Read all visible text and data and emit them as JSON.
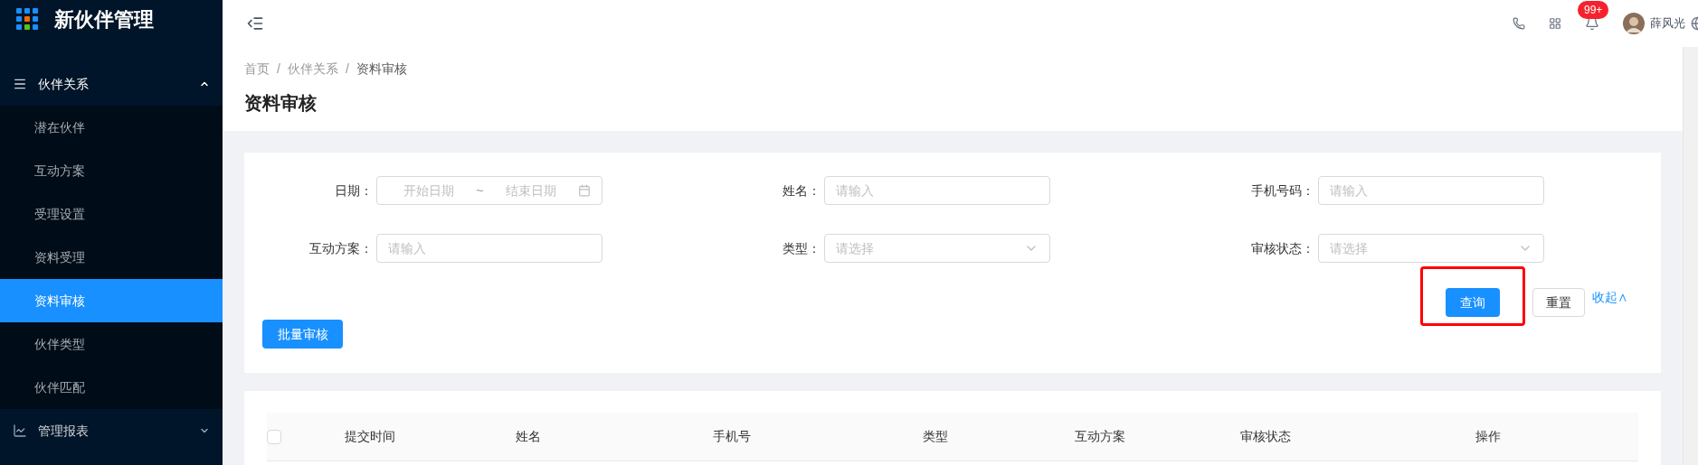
{
  "app": {
    "title": "新伙伴管理"
  },
  "sidebar": {
    "groups": [
      {
        "label": "伙伴关系",
        "kind": "list",
        "expanded": true,
        "children": [
          {
            "label": "潜在伙伴",
            "selected": false
          },
          {
            "label": "互动方案",
            "selected": false
          },
          {
            "label": "受理设置",
            "selected": false
          },
          {
            "label": "资料受理",
            "selected": false
          },
          {
            "label": "资料审核",
            "selected": true
          },
          {
            "label": "伙伴类型",
            "selected": false
          },
          {
            "label": "伙伴匹配",
            "selected": false
          }
        ]
      },
      {
        "label": "管理报表",
        "kind": "chart",
        "expanded": false
      }
    ]
  },
  "header": {
    "notification_badge": "99+",
    "user_name": "薛风光"
  },
  "breadcrumb": [
    {
      "label": "首页"
    },
    {
      "separator": "/",
      "label": "伙伴关系"
    },
    {
      "separator": "/",
      "label": "资料审核"
    }
  ],
  "page_title": "资料审核",
  "filters": [
    {
      "label": "日期：",
      "kind": "daterange",
      "start_placeholder": "开始日期",
      "separator": "~",
      "end_placeholder": "结束日期"
    },
    {
      "label": "姓名：",
      "kind": "input",
      "placeholder": "请输入"
    },
    {
      "label": "手机号码：",
      "kind": "input",
      "placeholder": "请输入"
    },
    {
      "label": "互动方案：",
      "kind": "input",
      "placeholder": "请输入"
    },
    {
      "label": "类型：",
      "kind": "select",
      "placeholder": "请选择"
    },
    {
      "label": "审核状态：",
      "kind": "select",
      "placeholder": "请选择"
    }
  ],
  "actions": {
    "query": "查询",
    "reset": "重置",
    "collapse": "收起∧",
    "highlighted": true
  },
  "batch_button": "批量审核",
  "table": {
    "select_all": false,
    "columns": [
      "提交时间",
      "姓名",
      "手机号",
      "类型",
      "互动方案",
      "审核状态",
      "操作"
    ]
  }
}
